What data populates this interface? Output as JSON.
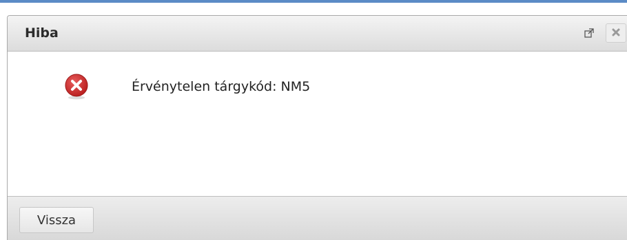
{
  "dialog": {
    "title": "Hiba",
    "message": "Érvénytelen tárgykód: NM5",
    "icons": {
      "maximize": "maximize-icon",
      "close": "close-icon",
      "status": "error-icon"
    },
    "buttons": {
      "back_label": "Vissza"
    }
  },
  "colors": {
    "top_border": "#5b8bc6",
    "error_red": "#c62828",
    "titlebar": "#e6e6e6"
  }
}
